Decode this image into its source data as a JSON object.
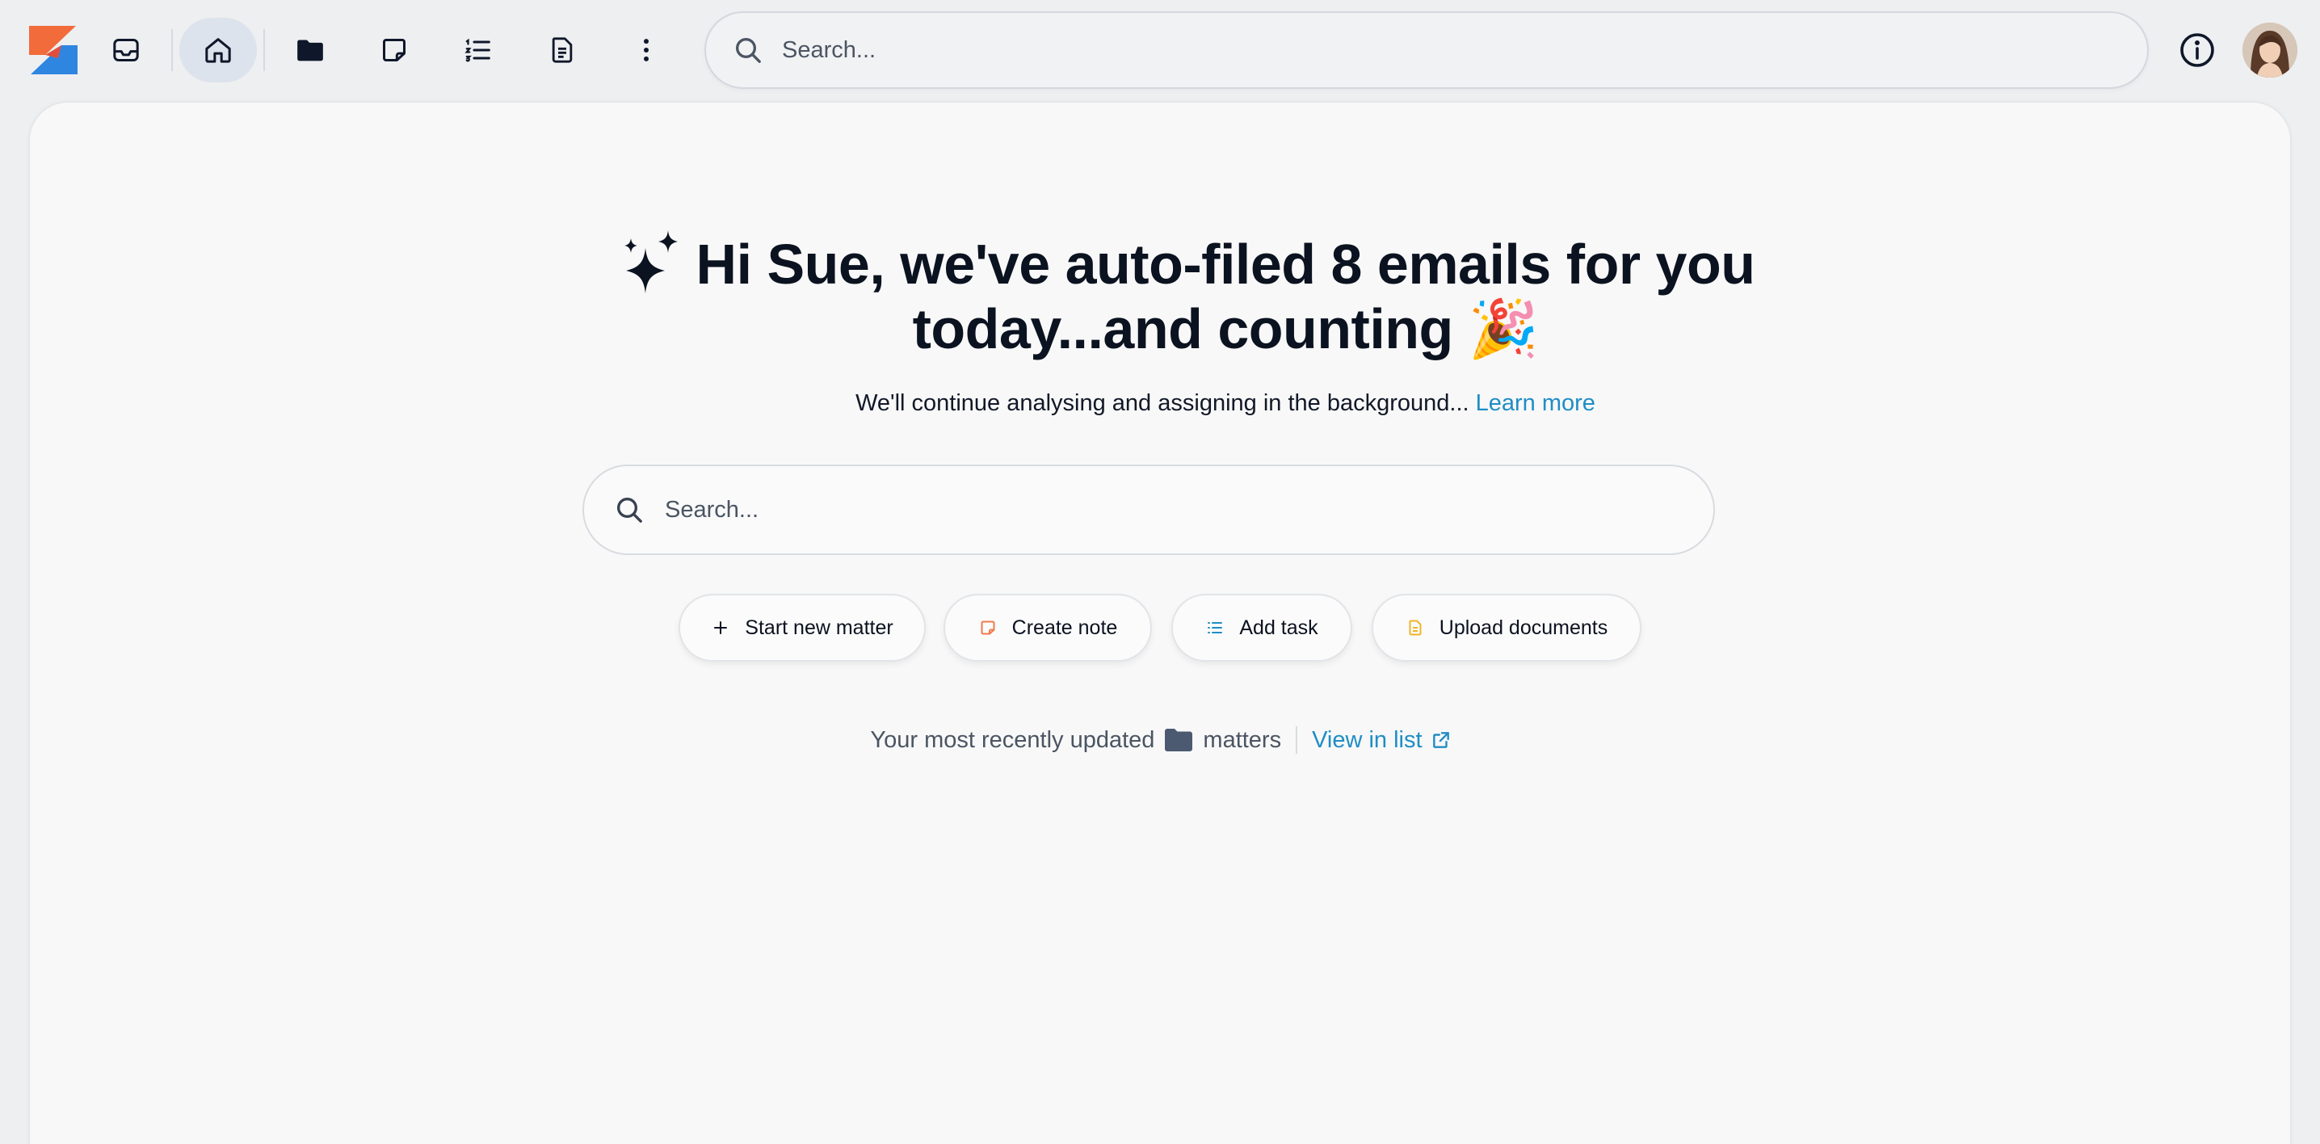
{
  "nav": {
    "items": [
      {
        "name": "inbox"
      },
      {
        "name": "home",
        "active": true
      },
      {
        "name": "matters"
      },
      {
        "name": "notes"
      },
      {
        "name": "tasks"
      },
      {
        "name": "documents"
      },
      {
        "name": "more"
      }
    ],
    "search_placeholder": "Search..."
  },
  "hero": {
    "title": "Hi Sue, we've auto-filed 8 emails for you today...and counting 🎉",
    "subtitle": "We'll continue analysing and assigning in the background...",
    "learn_more": "Learn more"
  },
  "search": {
    "placeholder": "Search..."
  },
  "actions": [
    {
      "label": "Start new matter",
      "icon": "plus-icon",
      "color": "#0b1220"
    },
    {
      "label": "Create note",
      "icon": "note-icon",
      "color": "#f07a4b"
    },
    {
      "label": "Add task",
      "icon": "task-list-icon",
      "color": "#1f8dc6"
    },
    {
      "label": "Upload documents",
      "icon": "document-icon",
      "color": "#f0b429"
    }
  ],
  "recent": {
    "prefix": "Your most recently updated",
    "entity": "matters",
    "view_link": "View in list"
  },
  "colors": {
    "accent": "#1f8dc6",
    "logo_orange": "#f26b3a",
    "logo_blue": "#2f86e0"
  }
}
